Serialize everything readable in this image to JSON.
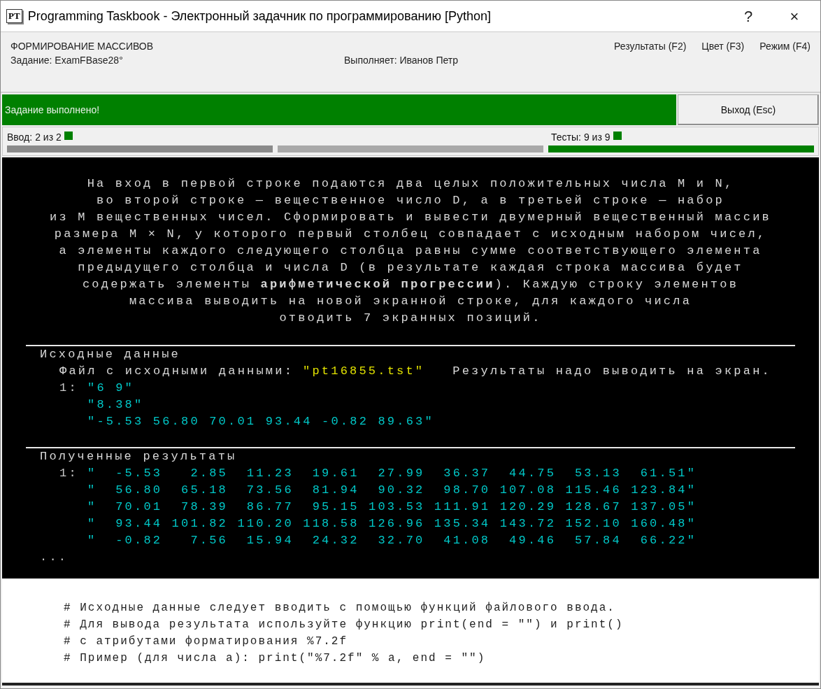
{
  "window": {
    "title": "Programming Taskbook - Электронный задачник по программированию [Python]",
    "logo": "PT",
    "buttons": [
      "?",
      "×"
    ]
  },
  "header": {
    "group": "ФОРМИРОВАНИЕ МАССИВОВ",
    "task": "Задание: ExamFBase28°",
    "student": "Выполняет: Иванов Петр",
    "menu": [
      "Результаты (F2)",
      "Цвет (F3)",
      "Режим (F4)"
    ]
  },
  "status": {
    "message": "Задание выполнено!",
    "success": true,
    "exit_button": "Выход (Esc)"
  },
  "progress": {
    "input": {
      "label": "Ввод:",
      "count": "2 из 2",
      "ok": true
    },
    "tests": {
      "label": "Тесты:",
      "count": "9 из 9",
      "ok": true
    },
    "segments": [
      {
        "kind": "input"
      },
      {
        "kind": "pending"
      },
      {
        "kind": "passed"
      }
    ]
  },
  "task_text": "На вход в первой строке подаются два целых положительных числа M и N,\nво второй строке — вещественное число D, а в третьей строке — набор\nиз M вещественных чисел. Сформировать и вывести двумерный вещественный массив\nразмера M × N, у которого первый столбец совпадает с исходным набором чисел,\nа элементы каждого следующего столбца равны сумме соответствующего элемента\nпредыдущего столбца и числа D (в результате каждая строка массива будет\nсодержать элементы **арифметической прогрессии**). Каждую строку элементов\nмассива выводить на новой экранной строке, для каждого числа\nотводить 7 экранных позиций.",
  "input_data": {
    "heading": "Исходные данные",
    "file_label": "Файл с исходными данными:",
    "file_name": "\"pt16855.tst\"",
    "note": "Результаты надо выводить на экран.",
    "lines": [
      {
        "label": "1:",
        "value": "\"6 9\""
      },
      {
        "value": "\"8.38\""
      },
      {
        "value": "\"-5.53 56.80 70.01 93.44 -0.82 89.63\""
      }
    ]
  },
  "results": {
    "heading": "Полученные результаты",
    "lines": [
      {
        "label": "1:",
        "value": "\"  -5.53   2.85  11.23  19.61  27.99  36.37  44.75  53.13  61.51\""
      },
      {
        "value": "\"  56.80  65.18  73.56  81.94  90.32  98.70 107.08 115.46 123.84\""
      },
      {
        "value": "\"  70.01  78.39  86.77  95.15 103.53 111.91 120.29 128.67 137.05\""
      },
      {
        "value": "\"  93.44 101.82 110.20 118.58 126.96 135.34 143.72 152.10 160.48\""
      },
      {
        "value": "\"  -0.82   7.56  15.94  24.32  32.70  41.08  49.46  57.84  66.22\""
      }
    ],
    "more": "..."
  },
  "hints": [
    "# Исходные данные следует вводить с помощью функций файлового ввода.",
    "# Для вывода результата используйте функцию print(end = \"\") и print()",
    "# с атрибутами форматирования %7.2f",
    "# Пример (для числа a): print(\"%7.2f\" % a, end = \"\")"
  ]
}
